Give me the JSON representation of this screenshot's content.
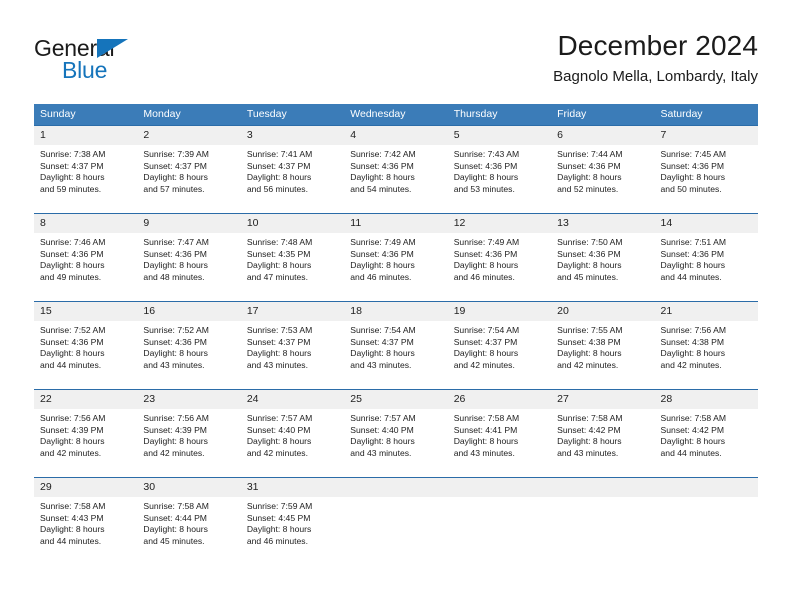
{
  "brand": {
    "name_top": "General",
    "name_bottom": "Blue",
    "accent_color": "#1574bb"
  },
  "header": {
    "title": "December 2024",
    "subtitle": "Bagnolo Mella, Lombardy, Italy"
  },
  "calendar": {
    "header_bg": "#3b7cb8",
    "daynum_bg": "#f0f0f0",
    "border_color": "#2b6ca8",
    "weekday_labels": [
      "Sunday",
      "Monday",
      "Tuesday",
      "Wednesday",
      "Thursday",
      "Friday",
      "Saturday"
    ],
    "weeks": [
      [
        {
          "day": "1",
          "sunrise": "Sunrise: 7:38 AM",
          "sunset": "Sunset: 4:37 PM",
          "daylight_1": "Daylight: 8 hours",
          "daylight_2": "and 59 minutes."
        },
        {
          "day": "2",
          "sunrise": "Sunrise: 7:39 AM",
          "sunset": "Sunset: 4:37 PM",
          "daylight_1": "Daylight: 8 hours",
          "daylight_2": "and 57 minutes."
        },
        {
          "day": "3",
          "sunrise": "Sunrise: 7:41 AM",
          "sunset": "Sunset: 4:37 PM",
          "daylight_1": "Daylight: 8 hours",
          "daylight_2": "and 56 minutes."
        },
        {
          "day": "4",
          "sunrise": "Sunrise: 7:42 AM",
          "sunset": "Sunset: 4:36 PM",
          "daylight_1": "Daylight: 8 hours",
          "daylight_2": "and 54 minutes."
        },
        {
          "day": "5",
          "sunrise": "Sunrise: 7:43 AM",
          "sunset": "Sunset: 4:36 PM",
          "daylight_1": "Daylight: 8 hours",
          "daylight_2": "and 53 minutes."
        },
        {
          "day": "6",
          "sunrise": "Sunrise: 7:44 AM",
          "sunset": "Sunset: 4:36 PM",
          "daylight_1": "Daylight: 8 hours",
          "daylight_2": "and 52 minutes."
        },
        {
          "day": "7",
          "sunrise": "Sunrise: 7:45 AM",
          "sunset": "Sunset: 4:36 PM",
          "daylight_1": "Daylight: 8 hours",
          "daylight_2": "and 50 minutes."
        }
      ],
      [
        {
          "day": "8",
          "sunrise": "Sunrise: 7:46 AM",
          "sunset": "Sunset: 4:36 PM",
          "daylight_1": "Daylight: 8 hours",
          "daylight_2": "and 49 minutes."
        },
        {
          "day": "9",
          "sunrise": "Sunrise: 7:47 AM",
          "sunset": "Sunset: 4:36 PM",
          "daylight_1": "Daylight: 8 hours",
          "daylight_2": "and 48 minutes."
        },
        {
          "day": "10",
          "sunrise": "Sunrise: 7:48 AM",
          "sunset": "Sunset: 4:35 PM",
          "daylight_1": "Daylight: 8 hours",
          "daylight_2": "and 47 minutes."
        },
        {
          "day": "11",
          "sunrise": "Sunrise: 7:49 AM",
          "sunset": "Sunset: 4:36 PM",
          "daylight_1": "Daylight: 8 hours",
          "daylight_2": "and 46 minutes."
        },
        {
          "day": "12",
          "sunrise": "Sunrise: 7:49 AM",
          "sunset": "Sunset: 4:36 PM",
          "daylight_1": "Daylight: 8 hours",
          "daylight_2": "and 46 minutes."
        },
        {
          "day": "13",
          "sunrise": "Sunrise: 7:50 AM",
          "sunset": "Sunset: 4:36 PM",
          "daylight_1": "Daylight: 8 hours",
          "daylight_2": "and 45 minutes."
        },
        {
          "day": "14",
          "sunrise": "Sunrise: 7:51 AM",
          "sunset": "Sunset: 4:36 PM",
          "daylight_1": "Daylight: 8 hours",
          "daylight_2": "and 44 minutes."
        }
      ],
      [
        {
          "day": "15",
          "sunrise": "Sunrise: 7:52 AM",
          "sunset": "Sunset: 4:36 PM",
          "daylight_1": "Daylight: 8 hours",
          "daylight_2": "and 44 minutes."
        },
        {
          "day": "16",
          "sunrise": "Sunrise: 7:52 AM",
          "sunset": "Sunset: 4:36 PM",
          "daylight_1": "Daylight: 8 hours",
          "daylight_2": "and 43 minutes."
        },
        {
          "day": "17",
          "sunrise": "Sunrise: 7:53 AM",
          "sunset": "Sunset: 4:37 PM",
          "daylight_1": "Daylight: 8 hours",
          "daylight_2": "and 43 minutes."
        },
        {
          "day": "18",
          "sunrise": "Sunrise: 7:54 AM",
          "sunset": "Sunset: 4:37 PM",
          "daylight_1": "Daylight: 8 hours",
          "daylight_2": "and 43 minutes."
        },
        {
          "day": "19",
          "sunrise": "Sunrise: 7:54 AM",
          "sunset": "Sunset: 4:37 PM",
          "daylight_1": "Daylight: 8 hours",
          "daylight_2": "and 42 minutes."
        },
        {
          "day": "20",
          "sunrise": "Sunrise: 7:55 AM",
          "sunset": "Sunset: 4:38 PM",
          "daylight_1": "Daylight: 8 hours",
          "daylight_2": "and 42 minutes."
        },
        {
          "day": "21",
          "sunrise": "Sunrise: 7:56 AM",
          "sunset": "Sunset: 4:38 PM",
          "daylight_1": "Daylight: 8 hours",
          "daylight_2": "and 42 minutes."
        }
      ],
      [
        {
          "day": "22",
          "sunrise": "Sunrise: 7:56 AM",
          "sunset": "Sunset: 4:39 PM",
          "daylight_1": "Daylight: 8 hours",
          "daylight_2": "and 42 minutes."
        },
        {
          "day": "23",
          "sunrise": "Sunrise: 7:56 AM",
          "sunset": "Sunset: 4:39 PM",
          "daylight_1": "Daylight: 8 hours",
          "daylight_2": "and 42 minutes."
        },
        {
          "day": "24",
          "sunrise": "Sunrise: 7:57 AM",
          "sunset": "Sunset: 4:40 PM",
          "daylight_1": "Daylight: 8 hours",
          "daylight_2": "and 42 minutes."
        },
        {
          "day": "25",
          "sunrise": "Sunrise: 7:57 AM",
          "sunset": "Sunset: 4:40 PM",
          "daylight_1": "Daylight: 8 hours",
          "daylight_2": "and 43 minutes."
        },
        {
          "day": "26",
          "sunrise": "Sunrise: 7:58 AM",
          "sunset": "Sunset: 4:41 PM",
          "daylight_1": "Daylight: 8 hours",
          "daylight_2": "and 43 minutes."
        },
        {
          "day": "27",
          "sunrise": "Sunrise: 7:58 AM",
          "sunset": "Sunset: 4:42 PM",
          "daylight_1": "Daylight: 8 hours",
          "daylight_2": "and 43 minutes."
        },
        {
          "day": "28",
          "sunrise": "Sunrise: 7:58 AM",
          "sunset": "Sunset: 4:42 PM",
          "daylight_1": "Daylight: 8 hours",
          "daylight_2": "and 44 minutes."
        }
      ],
      [
        {
          "day": "29",
          "sunrise": "Sunrise: 7:58 AM",
          "sunset": "Sunset: 4:43 PM",
          "daylight_1": "Daylight: 8 hours",
          "daylight_2": "and 44 minutes."
        },
        {
          "day": "30",
          "sunrise": "Sunrise: 7:58 AM",
          "sunset": "Sunset: 4:44 PM",
          "daylight_1": "Daylight: 8 hours",
          "daylight_2": "and 45 minutes."
        },
        {
          "day": "31",
          "sunrise": "Sunrise: 7:59 AM",
          "sunset": "Sunset: 4:45 PM",
          "daylight_1": "Daylight: 8 hours",
          "daylight_2": "and 46 minutes."
        },
        {
          "day": "",
          "sunrise": "",
          "sunset": "",
          "daylight_1": "",
          "daylight_2": ""
        },
        {
          "day": "",
          "sunrise": "",
          "sunset": "",
          "daylight_1": "",
          "daylight_2": ""
        },
        {
          "day": "",
          "sunrise": "",
          "sunset": "",
          "daylight_1": "",
          "daylight_2": ""
        },
        {
          "day": "",
          "sunrise": "",
          "sunset": "",
          "daylight_1": "",
          "daylight_2": ""
        }
      ]
    ]
  }
}
